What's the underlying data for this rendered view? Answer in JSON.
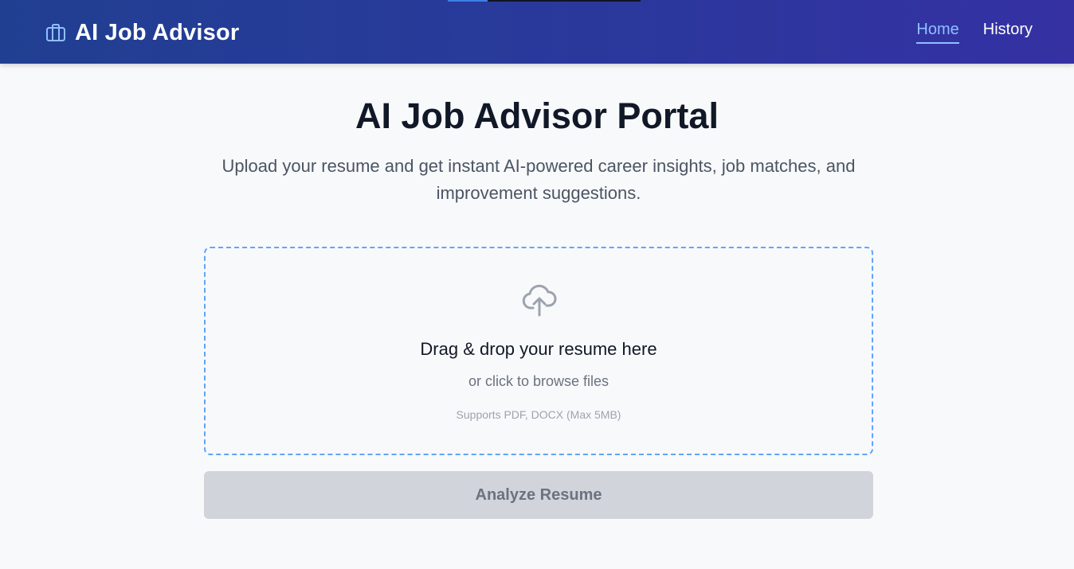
{
  "header": {
    "brand_title": "AI Job Advisor",
    "brand_icon": "briefcase-icon",
    "nav": [
      {
        "label": "Home",
        "active": true
      },
      {
        "label": "History",
        "active": false
      }
    ]
  },
  "main": {
    "title": "AI Job Advisor Portal",
    "subtitle": "Upload your resume and get instant AI-powered career insights, job matches, and improvement suggestions."
  },
  "dropzone": {
    "icon": "cloud-upload-icon",
    "title": "Drag & drop your resume here",
    "subtitle": "or click to browse files",
    "hint": "Supports PDF, DOCX (Max 5MB)"
  },
  "actions": {
    "analyze_label": "Analyze Resume"
  },
  "colors": {
    "header_start": "#213f91",
    "header_end": "#3531a3",
    "accent": "#60a5fa",
    "active_nav": "#8fc0ff",
    "button_disabled_bg": "#d1d5db"
  }
}
